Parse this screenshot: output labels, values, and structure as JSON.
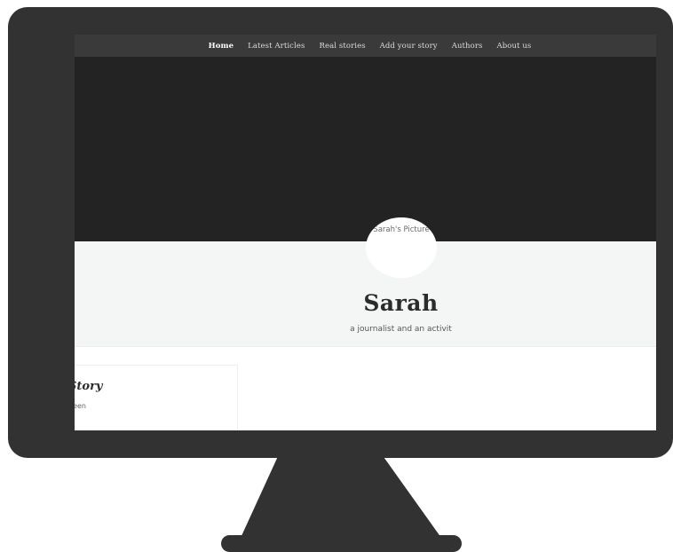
{
  "colors": {
    "monitor_frame": "#323232",
    "nav_bg": "#3a3a3a",
    "hero_bg": "#232323",
    "profile_band_bg": "#f4f6f5"
  },
  "nav": {
    "items": [
      {
        "label": "Home",
        "active": true
      },
      {
        "label": "Latest Articles"
      },
      {
        "label": "Real stories"
      },
      {
        "label": "Add your story"
      },
      {
        "label": "Authors"
      },
      {
        "label": "About us"
      }
    ]
  },
  "profile": {
    "avatar_alt": "Sarah's Picture",
    "name": "Sarah",
    "bio": "a journalist and an activit"
  },
  "card": {
    "title": "Story",
    "subtitle": "Seen"
  }
}
